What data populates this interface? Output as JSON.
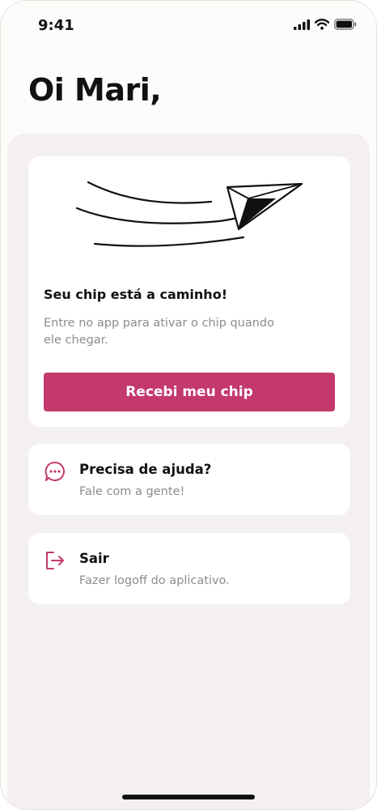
{
  "status_bar": {
    "time": "9:41"
  },
  "greeting": "Oi Mari,",
  "chip_card": {
    "title": "Seu chip está a caminho!",
    "description": "Entre no app para ativar o chip quando ele chegar.",
    "button_label": "Recebi meu chip"
  },
  "help_card": {
    "title": "Precisa de ajuda?",
    "subtitle": "Fale com a gente!",
    "icon": "chat-bubble-icon"
  },
  "logout_card": {
    "title": "Sair",
    "subtitle": "Fazer logoff do aplicativo.",
    "icon": "logout-icon"
  },
  "colors": {
    "accent": "#c4396d",
    "background": "#f4f0ef",
    "card": "#ffffff",
    "text_primary": "#111111",
    "text_secondary": "#8f8b89"
  }
}
